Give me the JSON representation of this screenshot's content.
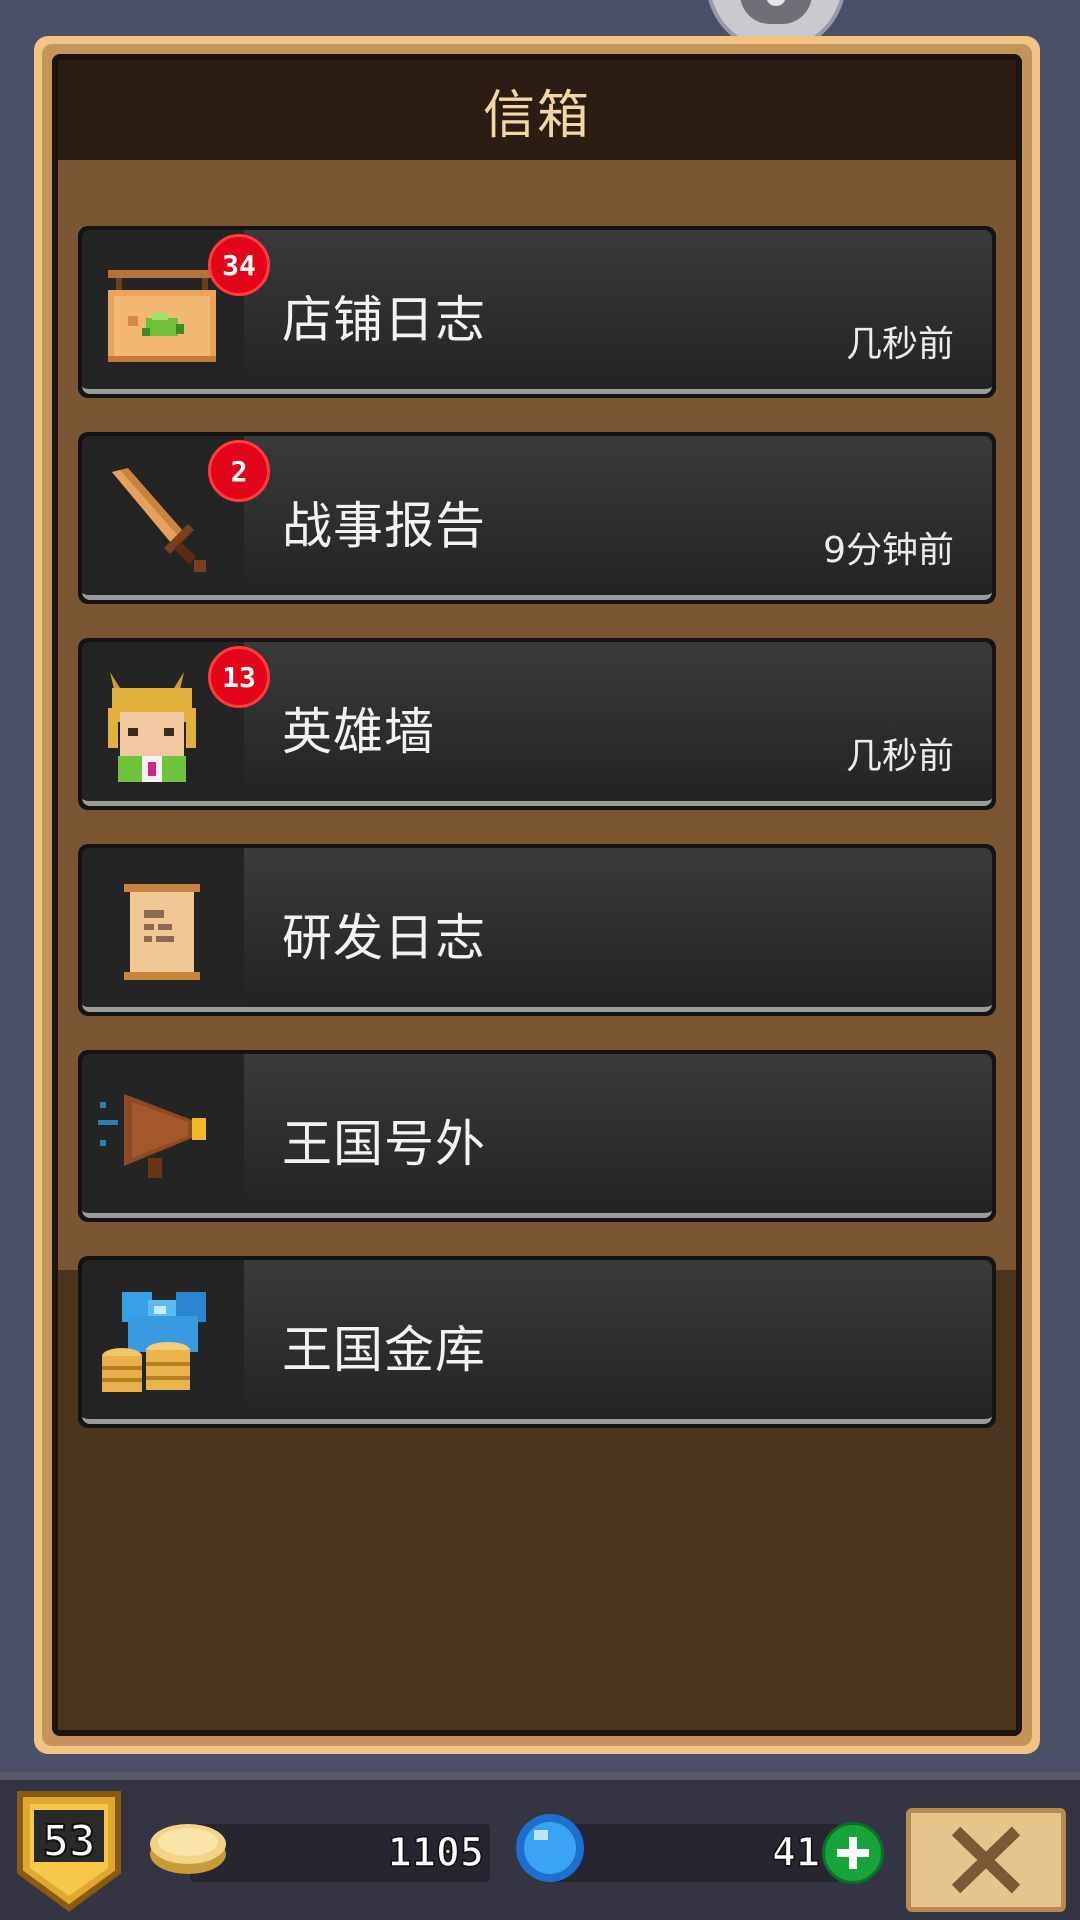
{
  "header": {
    "title": "信箱"
  },
  "mail_items": [
    {
      "label": "店铺日志",
      "time": "几秒前",
      "badge": "34",
      "icon": "shop-sign-icon"
    },
    {
      "label": "战事报告",
      "time": "9分钟前",
      "badge": "2",
      "icon": "sword-icon"
    },
    {
      "label": "英雄墙",
      "time": "几秒前",
      "badge": "13",
      "icon": "hero-portrait-icon"
    },
    {
      "label": "研发日志",
      "time": "",
      "badge": "",
      "icon": "scroll-icon"
    },
    {
      "label": "王国号外",
      "time": "",
      "badge": "",
      "icon": "megaphone-icon"
    },
    {
      "label": "王国金库",
      "time": "",
      "badge": "",
      "icon": "treasure-icon"
    }
  ],
  "bottom_bar": {
    "level": "53",
    "coins": "1105",
    "gems": "41",
    "plus_icon": "plus-icon",
    "close_icon": "close-icon"
  },
  "colors": {
    "badge": "#e3061b",
    "panel_border": "#f0c483",
    "header_bg": "#2b1d11",
    "row_bg": "#2f2f2f",
    "plus_green": "#16a43a"
  }
}
